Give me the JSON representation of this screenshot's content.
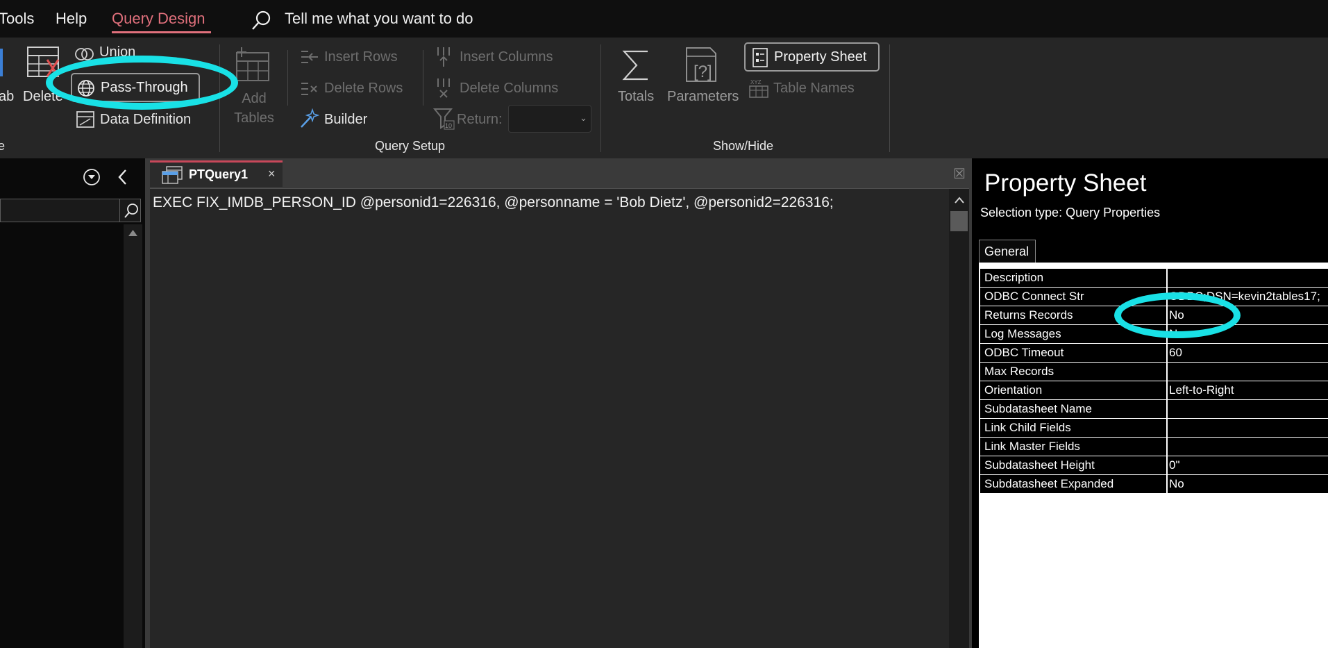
{
  "menubar": {
    "tabs": [
      "Tools",
      "Help",
      "Query Design"
    ],
    "active_tab": "Query Design",
    "tell_me": "Tell me what you want to do"
  },
  "ribbon": {
    "query_type": {
      "crosstab_partial": "ab",
      "delete_partial": "Delete",
      "union": "Union",
      "pass_through": "Pass-Through",
      "data_definition": "Data Definition",
      "group_label_partial": "e"
    },
    "query_setup": {
      "add_tables": "Add Tables",
      "insert_rows": "Insert Rows",
      "delete_rows": "Delete Rows",
      "builder": "Builder",
      "insert_columns": "Insert Columns",
      "delete_columns": "Delete Columns",
      "return_label": "Return:",
      "group_label": "Query Setup"
    },
    "show_hide": {
      "totals": "Totals",
      "parameters": "Parameters",
      "property_sheet": "Property Sheet",
      "table_names": "Table Names",
      "group_label": "Show/Hide"
    }
  },
  "document": {
    "tab_title": "PTQuery1",
    "sql": "EXEC FIX_IMDB_PERSON_ID @personid1=226316, @personname = 'Bob Dietz', @personid2=226316;"
  },
  "property_sheet": {
    "title": "Property Sheet",
    "selection_type": "Selection type:  Query Properties",
    "tab": "General",
    "rows": [
      {
        "name": "Description",
        "value": ""
      },
      {
        "name": "ODBC Connect Str",
        "value": "ODBC;DSN=kevin2tables17;"
      },
      {
        "name": "Returns Records",
        "value": "No"
      },
      {
        "name": "Log Messages",
        "value": "No"
      },
      {
        "name": "ODBC Timeout",
        "value": "60"
      },
      {
        "name": "Max Records",
        "value": ""
      },
      {
        "name": "Orientation",
        "value": "Left-to-Right"
      },
      {
        "name": "Subdatasheet Name",
        "value": ""
      },
      {
        "name": "Link Child Fields",
        "value": ""
      },
      {
        "name": "Link Master Fields",
        "value": ""
      },
      {
        "name": "Subdatasheet Height",
        "value": "0\""
      },
      {
        "name": "Subdatasheet Expanded",
        "value": "No"
      }
    ]
  },
  "annotations": {
    "highlight_color": "#19e1e6"
  },
  "colors": {
    "accent": "#e0707c",
    "ribbon_bg": "#262626",
    "doc_tab_border": "#c8485a"
  }
}
